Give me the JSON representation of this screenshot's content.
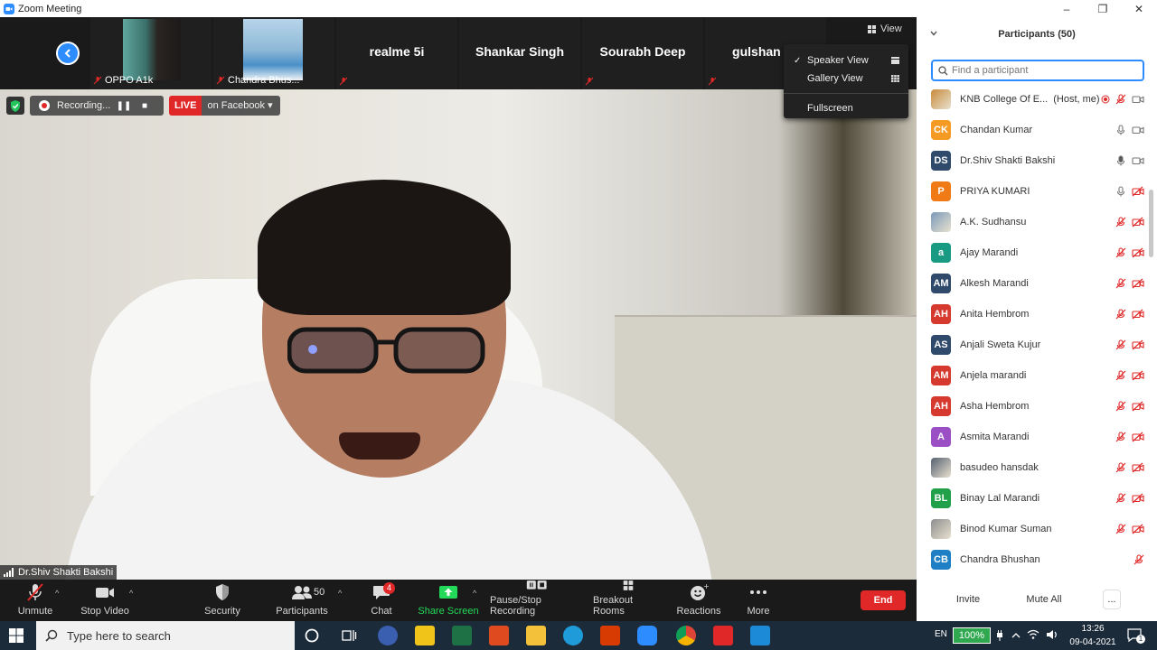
{
  "window": {
    "title": "Zoom Meeting",
    "minimize": "–",
    "maximize": "❐",
    "close": "✕"
  },
  "thumbnails": [
    {
      "name": "OPPO A1k",
      "has_video": true
    },
    {
      "name": "Chandra Bhus...",
      "has_video": true
    },
    {
      "name": "realme 5i",
      "has_video": false
    },
    {
      "name": "Shankar Singh",
      "has_video": false
    },
    {
      "name": "Sourabh Deep",
      "has_video": false
    },
    {
      "name": "gulshan ku",
      "has_video": false
    }
  ],
  "view": {
    "button_label": "View",
    "menu": [
      {
        "label": "Speaker View",
        "checked": true
      },
      {
        "label": "Gallery View",
        "checked": false
      },
      {
        "label": "Fullscreen",
        "checked": false
      }
    ]
  },
  "recording": {
    "label": "Recording...",
    "pause": "❚❚",
    "stop": "■"
  },
  "live": {
    "badge": "LIVE",
    "target": "on Facebook ▾"
  },
  "speaker": {
    "name": "Dr.Shiv Shakti Bakshi"
  },
  "toolbar": {
    "unmute": "Unmute",
    "stop_video": "Stop Video",
    "security": "Security",
    "participants": "Participants",
    "participants_count": "50",
    "chat": "Chat",
    "chat_badge": "4",
    "share_screen": "Share Screen",
    "pause_stop_recording": "Pause/Stop Recording",
    "breakout_rooms": "Breakout Rooms",
    "reactions": "Reactions",
    "more": "More",
    "end": "End",
    "caret": "^"
  },
  "participants_panel": {
    "title": "Participants (50)",
    "search_placeholder": "Find a participant",
    "invite": "Invite",
    "mute_all": "Mute All",
    "more": "...",
    "list": [
      {
        "initials": "",
        "name": "KNB College Of E...",
        "role": "(Host, me)",
        "color": "#c98b3a",
        "photo": true,
        "mic": "muted",
        "video": "on",
        "rec": true
      },
      {
        "initials": "CK",
        "name": "Chandan Kumar",
        "role": "",
        "color": "#f59a23",
        "photo": false,
        "mic": "on",
        "video": "on"
      },
      {
        "initials": "DS",
        "name": "Dr.Shiv Shakti Bakshi",
        "role": "",
        "color": "#2f4a6b",
        "photo": false,
        "mic": "active",
        "video": "on"
      },
      {
        "initials": "P",
        "name": "PRIYA KUMARI",
        "role": "",
        "color": "#f07a16",
        "photo": false,
        "mic": "on",
        "video": "off"
      },
      {
        "initials": "",
        "name": "A.K. Sudhansu",
        "role": "",
        "color": "#7a99b8",
        "photo": true,
        "mic": "muted",
        "video": "off"
      },
      {
        "initials": "a",
        "name": "Ajay Marandi",
        "role": "",
        "color": "#199a83",
        "photo": false,
        "mic": "muted",
        "video": "off"
      },
      {
        "initials": "AM",
        "name": "Alkesh Marandi",
        "role": "",
        "color": "#2f4a6b",
        "photo": false,
        "mic": "muted",
        "video": "off"
      },
      {
        "initials": "AH",
        "name": "Anita Hembrom",
        "role": "",
        "color": "#d63a2f",
        "photo": false,
        "mic": "muted",
        "video": "off"
      },
      {
        "initials": "AS",
        "name": "Anjali Sweta Kujur",
        "role": "",
        "color": "#2f4a6b",
        "photo": false,
        "mic": "muted",
        "video": "off"
      },
      {
        "initials": "AM",
        "name": "Anjela marandi",
        "role": "",
        "color": "#d63a2f",
        "photo": false,
        "mic": "muted",
        "video": "off"
      },
      {
        "initials": "AH",
        "name": "Asha Hembrom",
        "role": "",
        "color": "#d63a2f",
        "photo": false,
        "mic": "muted",
        "video": "off"
      },
      {
        "initials": "A",
        "name": "Asmita Marandi",
        "role": "",
        "color": "#9b4fc4",
        "photo": false,
        "mic": "muted",
        "video": "off"
      },
      {
        "initials": "",
        "name": "basudeo hansdak",
        "role": "",
        "color": "#556070",
        "photo": true,
        "mic": "muted",
        "video": "off"
      },
      {
        "initials": "BL",
        "name": "Binay Lal Marandi",
        "role": "",
        "color": "#21a04a",
        "photo": false,
        "mic": "muted",
        "video": "off"
      },
      {
        "initials": "",
        "name": "Binod Kumar Suman",
        "role": "",
        "color": "#8e8e8e",
        "photo": true,
        "mic": "muted",
        "video": "off"
      },
      {
        "initials": "CB",
        "name": "Chandra Bhushan",
        "role": "",
        "color": "#1e7fc4",
        "photo": false,
        "mic": "muted",
        "video": "none"
      }
    ]
  },
  "taskbar": {
    "search_placeholder": "Type here to search",
    "language": "EN",
    "battery": "100%",
    "time": "13:26",
    "date": "09-04-2021",
    "notification_count": "1"
  },
  "colors": {
    "accent": "#2d8cff",
    "danger": "#e02828",
    "share_green": "#23d959",
    "toolbar_bg": "#1a1a1a"
  }
}
